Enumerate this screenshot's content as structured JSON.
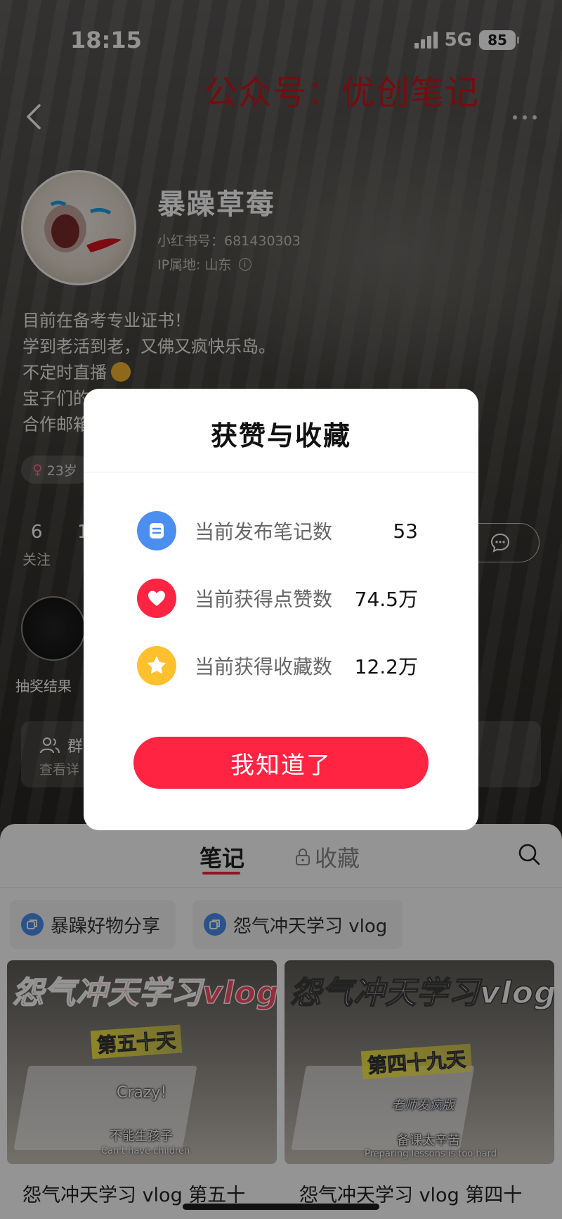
{
  "status_bar": {
    "time": "18:15",
    "network": "5G",
    "battery": "85"
  },
  "watermark": "公众号：优创笔记",
  "profile": {
    "nickname": "暴躁草莓",
    "user_id": "小红书号：681430303",
    "ip_location": "IP属地: 山东",
    "bio": [
      "目前在备考专业证书！",
      "学到老活到老，又佛又疯快乐岛。",
      "不定时直播",
      "宝子们的",
      "合作邮箱"
    ],
    "tag": "23岁",
    "stats": [
      {
        "num": "6",
        "label": "关注"
      },
      {
        "num": "1",
        "label": ""
      }
    ],
    "circle_label": "抽奖结果",
    "group": {
      "title": "群",
      "subtitle": "查看详"
    }
  },
  "tabs": {
    "notes": "笔记",
    "collect": "收藏"
  },
  "collections": [
    "暴躁好物分享",
    "怨气冲天学习 vlog"
  ],
  "cards": [
    {
      "overlay_title": "怨气冲天学习vlog",
      "day": "第五十天",
      "caption_1": "Crazy!",
      "caption_zh": "不能生孩子",
      "caption_en": "Can't have children",
      "title": "怨气冲天学习 vlog 第五十"
    },
    {
      "overlay_title": "怨气冲天学习vlog",
      "day": "第四十九天",
      "caption_1": "老师发疯版",
      "caption_zh": "备课太辛苦",
      "caption_en": "Preparing lessons is too hard",
      "title": "怨气冲天学习 vlog 第四十"
    }
  ],
  "modal": {
    "title": "获赞与收藏",
    "rows": [
      {
        "label": "当前发布笔记数",
        "value": "53",
        "icon": "note-icon",
        "color": "#4a8ef0"
      },
      {
        "label": "当前获得点赞数",
        "value": "74.5万",
        "icon": "heart-icon",
        "color": "#ff2442"
      },
      {
        "label": "当前获得收藏数",
        "value": "12.2万",
        "icon": "star-icon",
        "color": "#ffc02e"
      }
    ],
    "confirm": "我知道了"
  }
}
